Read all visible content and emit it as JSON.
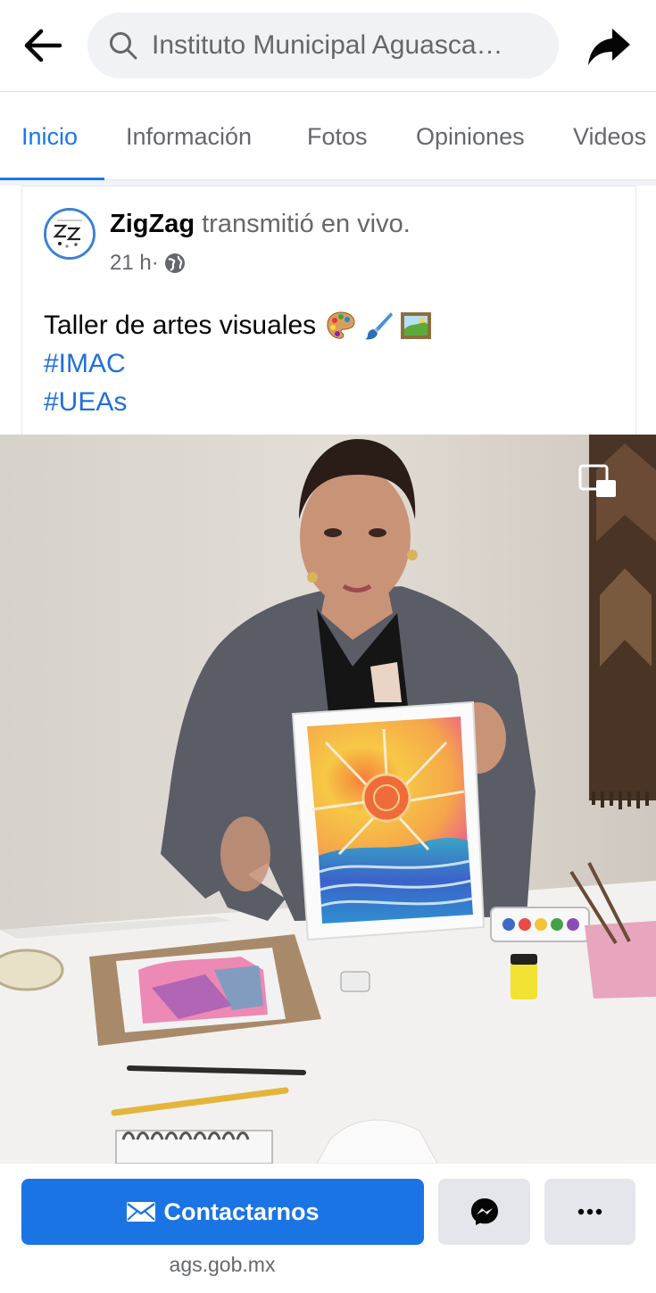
{
  "search": {
    "query": "Instituto Municipal Aguasca…"
  },
  "tabs": [
    {
      "label": "Inicio",
      "active": true
    },
    {
      "label": "Información",
      "active": false
    },
    {
      "label": "Fotos",
      "active": false
    },
    {
      "label": "Opiniones",
      "active": false
    },
    {
      "label": "Videos",
      "active": false
    }
  ],
  "post": {
    "author": "ZigZag",
    "action": " transmitió en vivo.",
    "time": "21 h",
    "separator": " · ",
    "privacy_icon": "globe-icon",
    "text_line1": "Taller de artes visuales",
    "emojis": [
      "palette-emoji",
      "paintbrush-emoji",
      "framed-picture-emoji"
    ],
    "hashtags": [
      "#IMAC",
      "#UEAs"
    ]
  },
  "video": {
    "pip_icon": "picture-in-picture-icon",
    "description_icons": [
      "woman-presenter",
      "sunset-watercolor-painting"
    ]
  },
  "actions": {
    "contact_label": "Contactarnos",
    "contact_icon": "mail-icon",
    "messenger_icon": "messenger-icon",
    "more_icon": "more-dots-icon",
    "website": "ags.gob.mx"
  },
  "colors": {
    "accent": "#1877f2",
    "button_blue": "#1b74e4",
    "secondary_text": "#65676b",
    "hashtag": "#216fdb"
  }
}
